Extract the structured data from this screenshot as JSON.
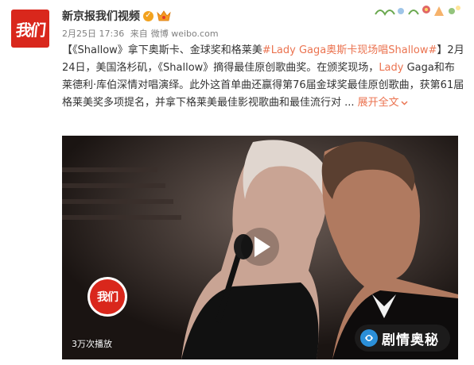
{
  "post": {
    "author": "新京报我们视频",
    "avatar_logo": "我们",
    "verified_icon": "verified-badge-icon",
    "member_icon": "vip-member-icon",
    "date": "2月25日 17:36",
    "via": "来自",
    "client": "微博 weibo.com",
    "text": {
      "open_bracket": "【",
      "title": "《Shallow》拿下奥斯卡、金球奖和格莱美",
      "hashtag": "#Lady Gaga奥斯卡现场唱Shallow#",
      "close_bracket": "】",
      "body1": "2月24日，美国洛杉矶，《Shallow》摘得最佳原创歌曲奖。在颁奖现场，",
      "name_link": "Lady",
      "body2": " Gaga和布莱德利·库伯深情对唱演绎。此外这首单曲还赢得第76届金球奖最佳原创歌曲，获第61届格莱美奖多项提名，并拿下格莱美最佳影视歌曲和最佳流行对 ... ",
      "expand": "展开全文",
      "expand_icon": "chevron-down-icon"
    }
  },
  "video": {
    "play_count": "3万次播放",
    "overlay_logo": "我们",
    "watermark": "剧情奥秘",
    "play_icon": "play-icon"
  },
  "colors": {
    "link": "#eb7350",
    "brand_red": "#d9271c"
  }
}
